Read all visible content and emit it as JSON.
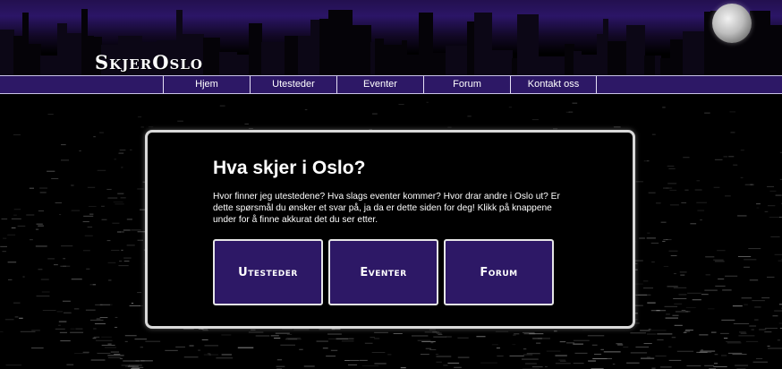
{
  "site": {
    "logo": "SkjerOslo"
  },
  "nav": [
    "Hjem",
    "Utesteder",
    "Eventer",
    "Forum",
    "Kontakt oss"
  ],
  "main": {
    "title": "Hva skjer i Oslo?",
    "intro": "Hvor finner jeg utestedene? Hva slags eventer kommer? Hvor drar andre i Oslo ut? Er dette spørsmål du ønsker et svar på, ja da er dette siden for deg! Klikk på knappene under for å finne akkurat det du ser etter.",
    "tiles": [
      "Utesteder",
      "Eventer",
      "Forum"
    ]
  },
  "colors": {
    "accent": "#2d1866",
    "background": "#000000",
    "border": "#d9d9d9"
  }
}
